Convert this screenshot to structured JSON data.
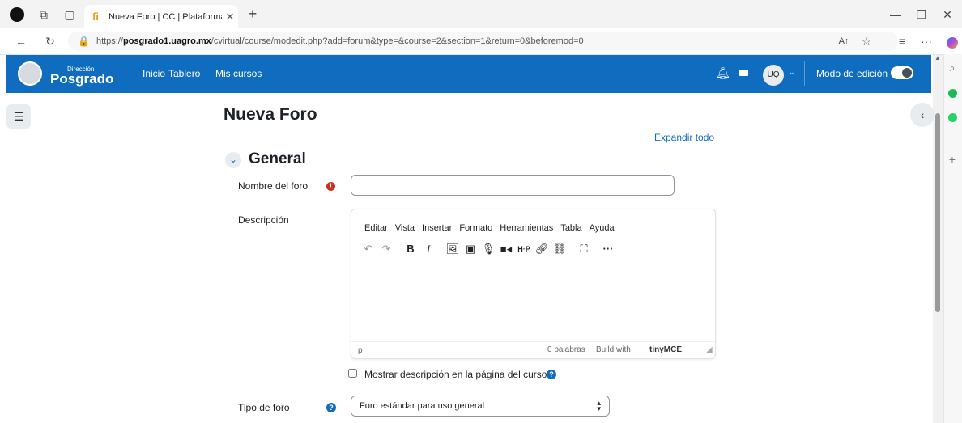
{
  "browser": {
    "tab_title": "Nueva Foro | CC | Plataforma virtu",
    "new_tab": "+",
    "url_prefix": "https://",
    "url_domain": "posgrado1.uagro.mx",
    "url_path": "/cvirtual/course/modedit.php?add=forum&type=&course=2&section=1&return=0&beforemod=0"
  },
  "navbar": {
    "logo_small": "Dirección",
    "logo_big": "Posgrado",
    "links": [
      "Inicio",
      "Tablero",
      "Mis cursos"
    ],
    "user_initials": "UQ",
    "edit_mode_label": "Modo de edición"
  },
  "page": {
    "title": "Nueva Foro",
    "expand_all": "Expandir todo",
    "section_title": "General",
    "forum_name_label": "Nombre del foro",
    "forum_name_value": "",
    "description_label": "Descripción",
    "editor_menu": [
      "Editar",
      "Vista",
      "Insertar",
      "Formato",
      "Herramientas",
      "Tabla",
      "Ayuda"
    ],
    "editor_path": "p",
    "word_count": "0 palabras",
    "build_with": "Build with",
    "tinymce": "tinyMCE",
    "show_description_label": "Mostrar descripción en la página del curso",
    "forum_type_label": "Tipo de foro",
    "forum_type_value": "Foro estándar para uso general"
  },
  "colors": {
    "brand": "#0f6cbf",
    "required": "#ca3120"
  }
}
